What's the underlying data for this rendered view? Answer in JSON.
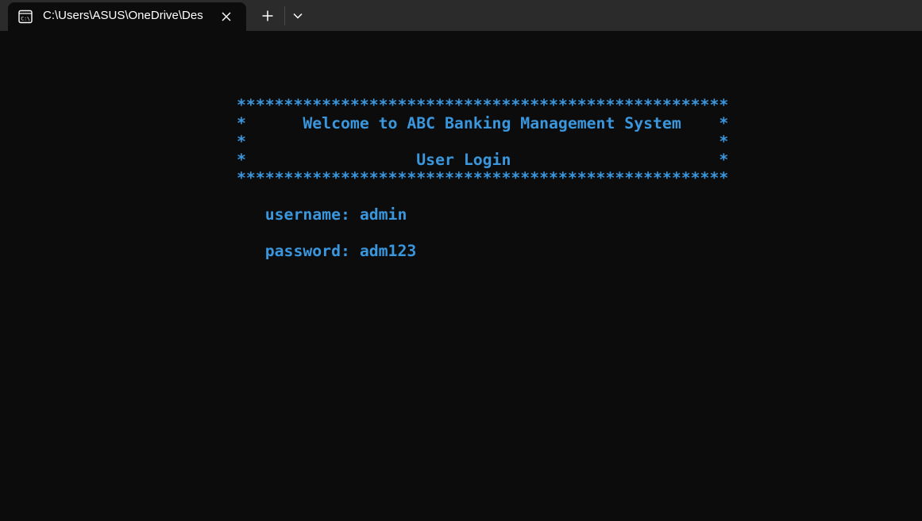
{
  "window": {
    "tab_title": "C:\\Users\\ASUS\\OneDrive\\Des",
    "tab_icon": "terminal-icon",
    "close_icon": "close-icon",
    "new_tab_icon": "plus-icon",
    "dropdown_icon": "chevron-down-icon"
  },
  "colors": {
    "terminal_background": "#0c0c0c",
    "titlebar_background": "#2b2b2b",
    "text": "#3a96dd"
  },
  "terminal": {
    "banner_border_top": "****************************************************",
    "banner_line_welcome": "*      Welcome to ABC Banking Management System    *",
    "banner_line_blank": "*                                                  *",
    "banner_line_login": "*                  User Login                      *",
    "banner_border_bottom": "****************************************************",
    "username_line": "   username: admin",
    "password_line": "   password: adm123"
  }
}
